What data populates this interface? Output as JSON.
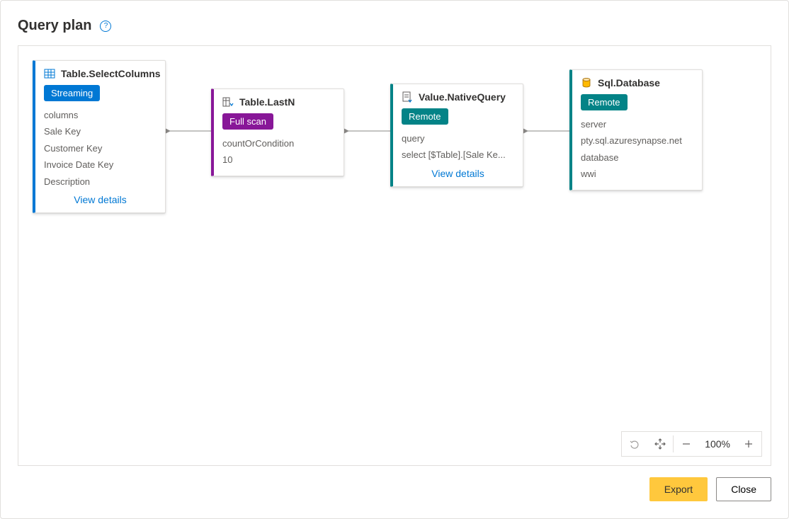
{
  "header": {
    "title": "Query plan"
  },
  "nodes": {
    "selectColumns": {
      "title": "Table.SelectColumns",
      "badge": "Streaming",
      "rows": [
        "columns",
        "Sale Key",
        "Customer Key",
        "Invoice Date Key",
        "Description"
      ],
      "viewDetails": "View details"
    },
    "lastN": {
      "title": "Table.LastN",
      "badge": "Full scan",
      "rows": [
        "countOrCondition",
        "10"
      ]
    },
    "nativeQuery": {
      "title": "Value.NativeQuery",
      "badge": "Remote",
      "rows": [
        "query",
        "select [$Table].[Sale Ke..."
      ],
      "viewDetails": "View details"
    },
    "sqlDatabase": {
      "title": "Sql.Database",
      "badge": "Remote",
      "rows": [
        "server",
        "pty.sql.azuresynapse.net",
        "database",
        "wwi"
      ]
    }
  },
  "toolbar": {
    "zoom": "100%"
  },
  "footer": {
    "export": "Export",
    "close": "Close"
  }
}
